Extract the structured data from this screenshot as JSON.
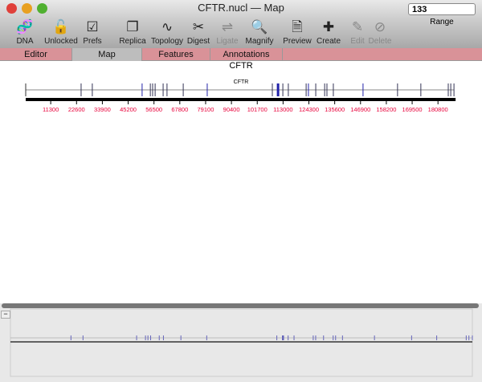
{
  "window": {
    "title": "CFTR.nucl — Map"
  },
  "toolbar": {
    "items": [
      {
        "label": "DNA",
        "icon": "dna-icon",
        "enabled": true
      },
      {
        "label": "Unlocked",
        "icon": "unlocked-icon",
        "enabled": true
      },
      {
        "label": "Prefs",
        "icon": "prefs-icon",
        "enabled": true
      },
      {
        "label": "Replica",
        "icon": "replica-icon",
        "enabled": true
      },
      {
        "label": "Topology",
        "icon": "topology-icon",
        "enabled": true
      },
      {
        "label": "Digest",
        "icon": "digest-icon",
        "enabled": true
      },
      {
        "label": "Ligate",
        "icon": "ligate-icon",
        "enabled": false
      },
      {
        "label": "Magnify",
        "icon": "magnify-icon",
        "enabled": true
      },
      {
        "label": "Preview",
        "icon": "preview-icon",
        "enabled": true
      },
      {
        "label": "Create",
        "icon": "create-icon",
        "enabled": true
      },
      {
        "label": "Edit",
        "icon": "edit-icon",
        "enabled": false
      },
      {
        "label": "Delete",
        "icon": "delete-icon",
        "enabled": false
      }
    ],
    "range_value": "133",
    "range_label": "Range"
  },
  "tabs": [
    {
      "label": "Editor"
    },
    {
      "label": "Map",
      "selected": true
    },
    {
      "label": "Features"
    },
    {
      "label": "Annotations"
    }
  ],
  "map": {
    "title": "CFTR",
    "feature_label": "CFTR",
    "length": 187800,
    "ticks": [
      "11300",
      "22600",
      "33900",
      "45200",
      "56500",
      "67800",
      "79100",
      "90400",
      "101700",
      "113000",
      "124300",
      "135600",
      "146900",
      "158200",
      "169500",
      "180800"
    ],
    "exons": [
      {
        "pos": 24600
      },
      {
        "pos": 29500
      },
      {
        "pos": 51300,
        "blue": true
      },
      {
        "pos": 54900
      },
      {
        "pos": 55900
      },
      {
        "pos": 57000
      },
      {
        "pos": 60500
      },
      {
        "pos": 62200
      },
      {
        "pos": 69300
      },
      {
        "pos": 79800,
        "blue": true
      },
      {
        "pos": 108300
      },
      {
        "pos": 110800,
        "blue": true,
        "thick": true
      },
      {
        "pos": 112900
      },
      {
        "pos": 115300
      },
      {
        "pos": 123100
      },
      {
        "pos": 124100,
        "blue": true
      },
      {
        "pos": 127300
      },
      {
        "pos": 131200
      },
      {
        "pos": 132200
      },
      {
        "pos": 135000
      },
      {
        "pos": 148000,
        "blue": true
      },
      {
        "pos": 163100
      },
      {
        "pos": 173300
      },
      {
        "pos": 185300
      },
      {
        "pos": 186400
      },
      {
        "pos": 187800
      }
    ],
    "colors": {
      "tick_label": "#e8003a",
      "exon": "#333355",
      "exon_blue": "#2222aa"
    }
  },
  "overview": {
    "collapse_label": "−"
  }
}
